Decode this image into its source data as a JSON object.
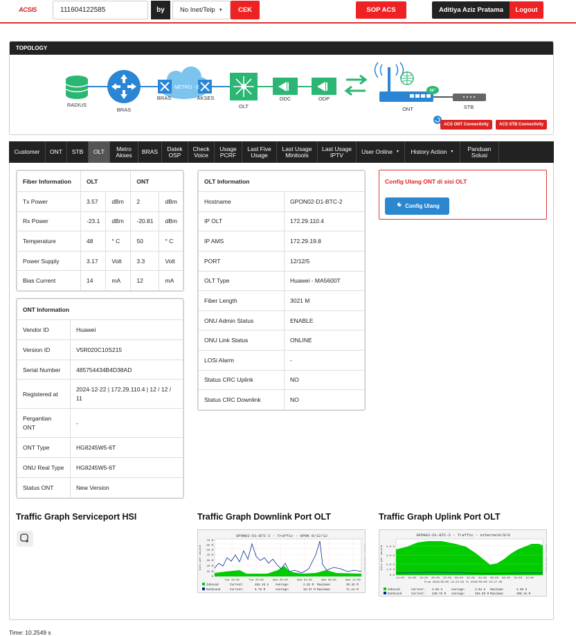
{
  "header": {
    "logo": "ACSIS",
    "search_value": "111604122585",
    "by_label": "by",
    "select_value": "No Inet/Telp",
    "cek_label": "CEK",
    "sop_label": "SOP ACS",
    "user_name": "Aditiya Aziz Pratama",
    "logout_label": "Logout"
  },
  "topology": {
    "title": "TOPOLOGY",
    "nodes": {
      "radius": "RADIUS",
      "bras1": "BRAS",
      "bras2": "BRAS",
      "metro": "METRO - E",
      "akses": "AKSES",
      "olt": "OLT",
      "odc": "ODC",
      "odp": "ODP",
      "ont": "ONT",
      "stb": "STB",
      "ont_badge": "56\""
    },
    "ont_connectivity": "ACS ONT Connectivity",
    "stb_connectivity": "ACS STB Connectivity",
    "colors": {
      "teal": "#2bb673",
      "blue": "#2a86d4",
      "cloud": "#7cc3ee"
    }
  },
  "tabs": [
    {
      "label": "Customer"
    },
    {
      "label": "ONT"
    },
    {
      "label": "STB"
    },
    {
      "label": "OLT",
      "active": true
    },
    {
      "label": "Metro\nAkses"
    },
    {
      "label": "BRAS"
    },
    {
      "label": "Datek\nOSP"
    },
    {
      "label": "Check\nVoice"
    },
    {
      "label": "Usage\nPCRF"
    },
    {
      "label": "Last Five\nUsage"
    },
    {
      "label": "Last Usage\nMinitools"
    },
    {
      "label": "Last Usage\nIPTV"
    },
    {
      "label": "User Online",
      "dropdown": true
    },
    {
      "label": "History Action",
      "dropdown": true
    },
    {
      "label": "Panduan\nSolusi"
    }
  ],
  "fiber": {
    "headers": [
      "Fiber Information",
      "OLT",
      "ONT"
    ],
    "rows": [
      [
        "Tx Power",
        "3.57",
        "dBm",
        "2",
        "dBm"
      ],
      [
        "Rx Power",
        "-23.1",
        "dBm",
        "-20.81",
        "dBm"
      ],
      [
        "Temperature",
        "48",
        "° C",
        "50",
        "° C"
      ],
      [
        "Power Supply",
        "3.17",
        "Volt",
        "3.3",
        "Volt"
      ],
      [
        "Bias Current",
        "14",
        "mA",
        "12",
        "mA"
      ]
    ]
  },
  "ont_info": {
    "title": "ONT Information",
    "rows": [
      [
        "Vendor ID",
        "Huawei"
      ],
      [
        "Version ID",
        "V5R020C10S215"
      ],
      [
        "Serial Number",
        "485754434B4D38AD"
      ],
      [
        "Registered at",
        "2024-12-22 | 172.29.110.4 | 12 / 12 / 11"
      ],
      [
        "Pergantian ONT",
        "-"
      ],
      [
        "ONT Type",
        "HG8245W5-6T"
      ],
      [
        "ONU Real Type",
        "HG8245W5-6T"
      ],
      [
        "Status ONT",
        "New Version"
      ]
    ]
  },
  "olt_info": {
    "title": "OLT Information",
    "rows": [
      [
        "Hostname",
        "GPON02-D1-BTC-2"
      ],
      [
        "IP OLT",
        "172.29.110.4"
      ],
      [
        "IP AMS",
        "172.29.19.8"
      ],
      [
        "PORT",
        "12/12/5"
      ],
      [
        "OLT Type",
        "Huawei - MA5600T"
      ],
      [
        "Fiber Length",
        "3021 M"
      ],
      [
        "ONU Admin Status",
        "ENABLE"
      ],
      [
        "ONU Link Status",
        "ONLINE"
      ],
      [
        "LOSi Alarm",
        "-"
      ],
      [
        "Status CRC Uplink",
        "NO"
      ],
      [
        "Status CRC Downlink",
        "NO"
      ]
    ]
  },
  "config": {
    "title": "Config Ulang ONT di sisi OLT",
    "button": "Config Ulang"
  },
  "graphs": {
    "hsi_title": "Traffic Graph Serviceport HSI",
    "downlink_title": "Traffic Graph Downlink Port OLT",
    "uplink_title": "Traffic Graph Uplink Port OLT",
    "downlink_caption": "GPON02-D1-BTC-2 - Traffic - GPON 0/12/12",
    "uplink_caption": "GPON02-D1-BTC-2 - Traffic - ethernet0/9/0",
    "downlink_y_ticks": [
      "70 M",
      "60 M",
      "50 M",
      "40 M",
      "30 M",
      "20 M",
      "10 M",
      "0"
    ],
    "downlink_x_ticks": [
      "Tue 16:00",
      "Tue 20:00",
      "Wed 00:00",
      "Wed 04:00",
      "Wed 08:00",
      "Wed 12:00"
    ],
    "uplink_y_ticks": [
      "4.0 G",
      "3.0 G",
      "2.0 G",
      "1.0 G",
      "0.0"
    ],
    "uplink_x_ticks": [
      "14:00",
      "16:00",
      "18:00",
      "20:00",
      "22:00",
      "00:00",
      "02:00",
      "04:00",
      "06:00",
      "08:00",
      "10:00",
      "12:00"
    ],
    "downlink_ylabel": "bits per second",
    "uplink_ylabel": "bits per second",
    "uplink_range": "From 2026/05/05 13:22:59 To 2026/05/06 13:17:59",
    "downlink_legend": [
      {
        "name": "Inbound",
        "current": "464.45 k",
        "average": "2.52 M",
        "maximum": "20.42 M",
        "color": "#00cc00"
      },
      {
        "name": "Outbound",
        "current": "6.79 M",
        "average": "18.37 M",
        "maximum": "71.13 M",
        "color": "#002a97"
      }
    ],
    "uplink_legend": [
      {
        "name": "Inbound",
        "current": "3.56 G",
        "average": "3.04 G",
        "maximum": "4.68 G",
        "color": "#00cc00"
      },
      {
        "name": "Outbound",
        "current": "240.75 M",
        "average": "264.99 M",
        "maximum": "408.16 M",
        "color": "#002a97"
      }
    ],
    "legend_labels": {
      "current": "Current:",
      "average": "Average:",
      "maximum": "Maximum:"
    },
    "side_tag": "RRDTOOL / TOBI OETIKER"
  },
  "footer": {
    "time": "Time: 10.2549 s"
  }
}
